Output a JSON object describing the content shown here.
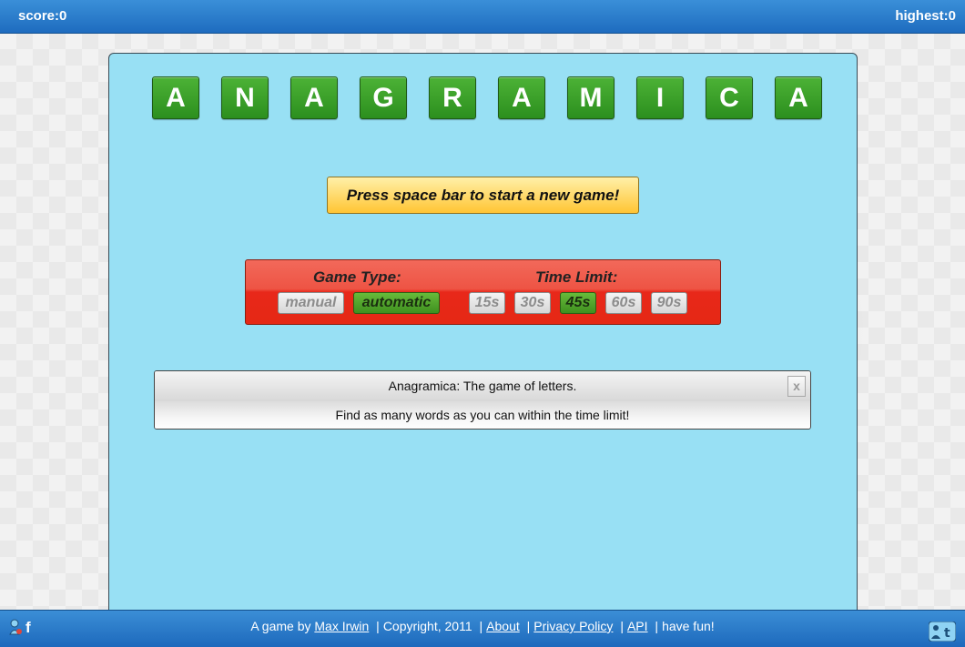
{
  "header": {
    "score": "score:0",
    "highest": "highest:0"
  },
  "title_tiles": [
    "A",
    "N",
    "A",
    "G",
    "R",
    "A",
    "M",
    "I",
    "C",
    "A"
  ],
  "start_button": "Press space bar to start a new game!",
  "options": {
    "game_type_label": "Game Type:",
    "game_types": [
      {
        "label": "manual",
        "selected": false
      },
      {
        "label": "automatic",
        "selected": true
      }
    ],
    "time_limit_label": "Time Limit:",
    "time_limits": [
      {
        "label": "15s",
        "selected": false
      },
      {
        "label": "30s",
        "selected": false
      },
      {
        "label": "45s",
        "selected": true
      },
      {
        "label": "60s",
        "selected": false
      },
      {
        "label": "90s",
        "selected": false
      }
    ]
  },
  "message": {
    "line1": "Anagramica: The game of letters.",
    "line2": "Find as many words as you can within the time limit!",
    "close_label": "x"
  },
  "footer": {
    "prefix": "A game by",
    "author": "Max Irwin",
    "sep": "|",
    "copyright": "Copyright, 2011",
    "about": "About",
    "privacy": "Privacy Policy",
    "api": "API",
    "have_fun": "have fun!",
    "left_icons": [
      "share-person-icon",
      "facebook-icon"
    ],
    "right_icons": [
      "share-person-icon",
      "twitter-icon"
    ]
  },
  "colors": {
    "header_blue": "#1e6cbf",
    "panel_bg": "#98e0f4",
    "tile_green": "#3ca02a",
    "start_yellow": "#ffc533",
    "options_red": "#e8281a",
    "selected_green": "#4f9f28"
  }
}
